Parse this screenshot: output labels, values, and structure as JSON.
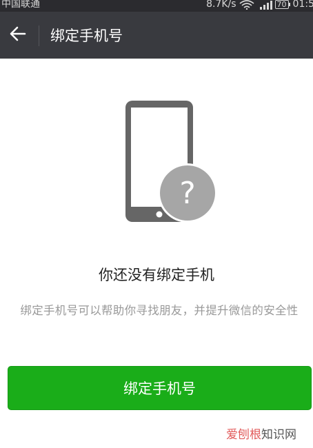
{
  "status_bar": {
    "carrier": "中国联通",
    "network_speed": "8.7K/s",
    "battery_level": "70",
    "time": "01:5"
  },
  "header": {
    "back_icon": "arrow-left-icon",
    "title": "绑定手机号"
  },
  "illustration": {
    "phone_icon": "phone-icon",
    "question_icon": "question-mark-icon"
  },
  "main": {
    "heading": "你还没有绑定手机",
    "description": "绑定手机号可以帮助你寻找朋友，并提升微信的安全性",
    "bind_button_label": "绑定手机号"
  },
  "watermark": {
    "part_a": "爱刨根",
    "part_b": "知识网"
  },
  "colors": {
    "title_bar": "#393a3f",
    "status_bar": "#2b2b2f",
    "primary_button": "#1aad19",
    "illustration_gray": "#666666",
    "badge_gray": "#a6a6a6"
  }
}
